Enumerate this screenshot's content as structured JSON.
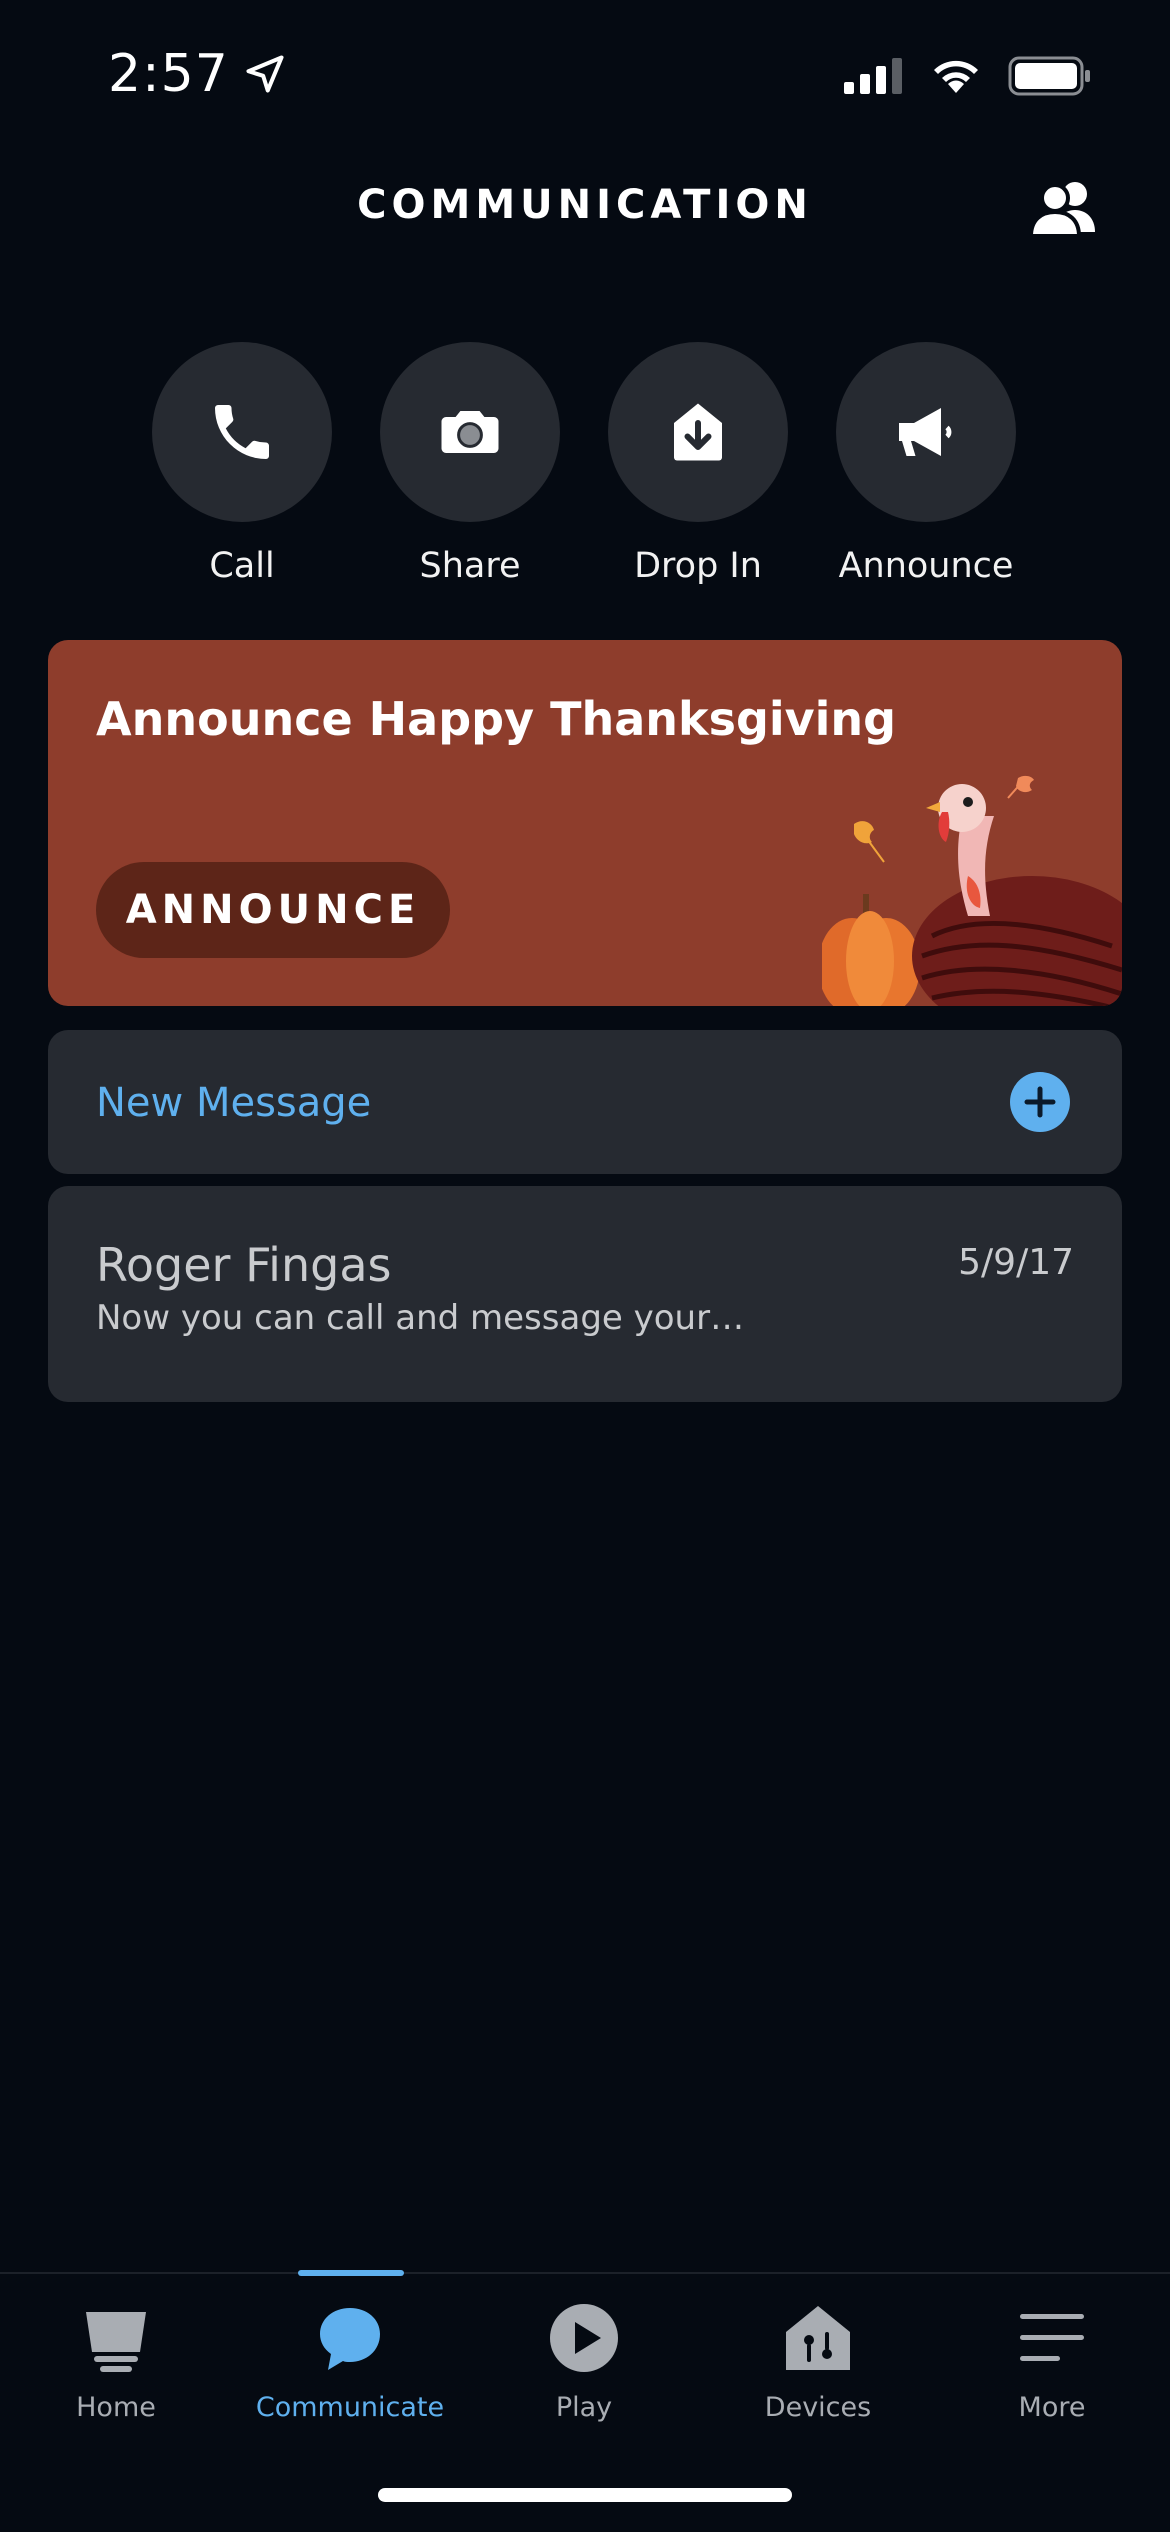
{
  "status_bar": {
    "time": "2:57"
  },
  "header": {
    "title": "COMMUNICATION",
    "contacts_icon": "contacts-icon"
  },
  "actions": [
    {
      "label": "Call",
      "icon": "phone-icon"
    },
    {
      "label": "Share",
      "icon": "camera-icon"
    },
    {
      "label": "Drop In",
      "icon": "drop-in-icon"
    },
    {
      "label": "Announce",
      "icon": "megaphone-icon"
    }
  ],
  "promo": {
    "title": "Announce Happy Thanksgiving",
    "button_label": "ANNOUNCE",
    "background_color": "#8e3d2c"
  },
  "new_message": {
    "label": "New Message",
    "accent_color": "#5fb0ee"
  },
  "conversations": [
    {
      "name": "Roger Fingas",
      "date": "5/9/17",
      "preview": "Now you can call and message your…"
    }
  ],
  "tabs": [
    {
      "label": "Home",
      "icon": "home-icon",
      "active": false
    },
    {
      "label": "Communicate",
      "icon": "chat-bubble-icon",
      "active": true
    },
    {
      "label": "Play",
      "icon": "play-icon",
      "active": false
    },
    {
      "label": "Devices",
      "icon": "devices-icon",
      "active": false
    },
    {
      "label": "More",
      "icon": "menu-icon",
      "active": false
    }
  ]
}
